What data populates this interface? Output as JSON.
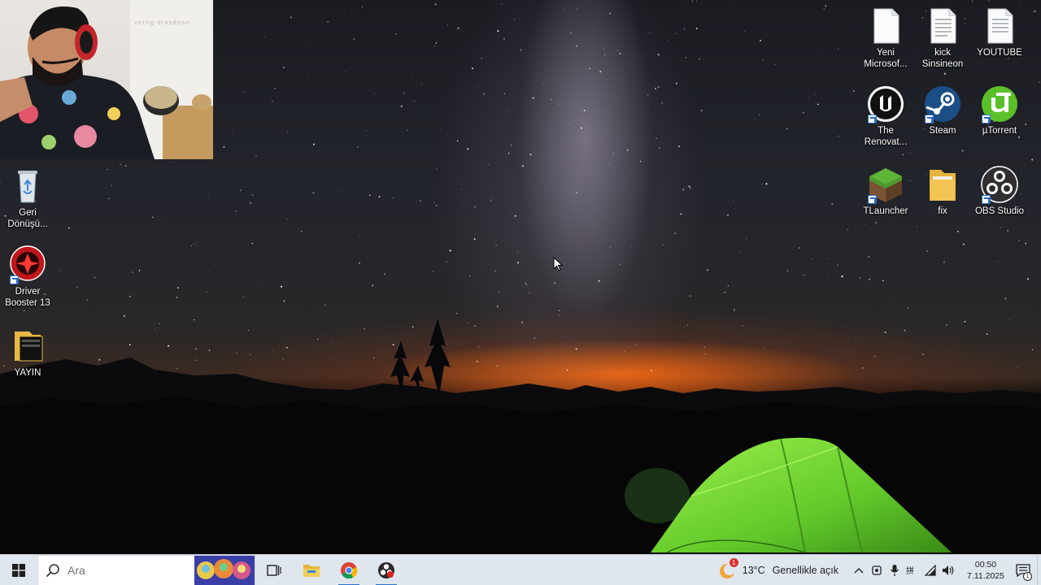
{
  "webcam": {
    "caption": "vetng drosdean"
  },
  "desktop_icons_left": [
    {
      "id": "recycle",
      "label": "Geri Dönüşü...",
      "icon": "recycle-bin-icon"
    },
    {
      "id": "driver",
      "label": "Driver Booster 13",
      "icon": "driver-booster-icon"
    },
    {
      "id": "yayin",
      "label": "YAYIN",
      "icon": "folder-icon"
    }
  ],
  "desktop_icons_right": [
    {
      "id": "yeni",
      "label": "Yeni Microsof...",
      "icon": "text-document-icon"
    },
    {
      "id": "kick",
      "label": "kick Sinsineon",
      "icon": "text-document-icon"
    },
    {
      "id": "youtube",
      "label": "YOUTUBE",
      "icon": "text-document-icon"
    },
    {
      "id": "unreal",
      "label": "The Renovat...",
      "icon": "unreal-engine-icon"
    },
    {
      "id": "steam",
      "label": "Steam",
      "icon": "steam-icon"
    },
    {
      "id": "utorrent",
      "label": "µTorrent",
      "icon": "utorrent-icon"
    },
    {
      "id": "tlauncher",
      "label": "TLauncher",
      "icon": "minecraft-grass-block-icon"
    },
    {
      "id": "fix",
      "label": "fix",
      "icon": "folder-icon"
    },
    {
      "id": "obs",
      "label": "OBS Studio",
      "icon": "obs-studio-icon"
    }
  ],
  "taskbar": {
    "search_placeholder": "Ara",
    "pinned": [
      {
        "id": "task-view",
        "icon": "task-view-icon"
      },
      {
        "id": "file-explorer",
        "icon": "file-explorer-icon"
      },
      {
        "id": "chrome",
        "icon": "chrome-icon",
        "active": true
      },
      {
        "id": "obs",
        "icon": "obs-recording-icon",
        "active": true
      }
    ],
    "weather": {
      "temp": "13°C",
      "condition": "Genellikle açık",
      "badge": "1"
    },
    "clock": {
      "time": "00:50",
      "date": "7.11.2025"
    },
    "notification_count": "1"
  },
  "colors": {
    "taskbar_bg": "#dfe6ee",
    "accent": "#2a73c9",
    "tent_green": "#7be43a",
    "horizon_orange": "#ff6e14"
  }
}
